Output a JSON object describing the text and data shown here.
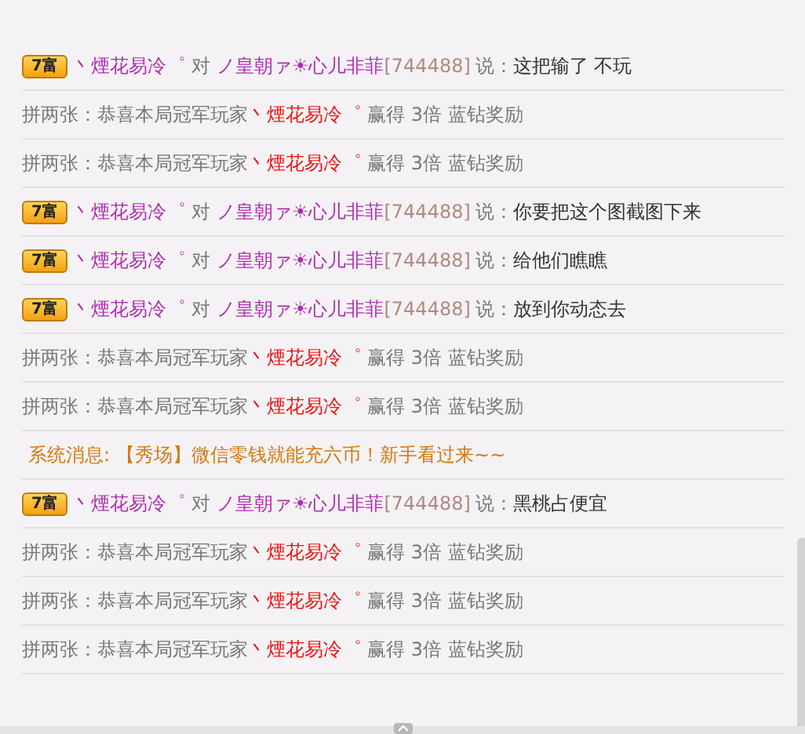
{
  "messages": [
    {
      "kind": "chat",
      "badge": "7富",
      "sender": "丶煙花易冷゜",
      "to": "对",
      "target": "ノ皇朝ァ☀心儿非菲",
      "id": "[744488]",
      "says": "说：",
      "text": "这把输了 不玩"
    },
    {
      "kind": "game",
      "prefix": "拼两张：恭喜本局冠军玩家",
      "winner": "丶煙花易冷゜",
      "reward": "赢得 3倍 蓝钻奖励"
    },
    {
      "kind": "game",
      "prefix": "拼两张：恭喜本局冠军玩家",
      "winner": "丶煙花易冷゜",
      "reward": "赢得 3倍 蓝钻奖励"
    },
    {
      "kind": "chat",
      "badge": "7富",
      "sender": "丶煙花易冷゜",
      "to": "对",
      "target": "ノ皇朝ァ☀心儿非菲",
      "id": "[744488]",
      "says": "说：",
      "text": "你要把这个图截图下来"
    },
    {
      "kind": "chat",
      "badge": "7富",
      "sender": "丶煙花易冷゜",
      "to": "对",
      "target": "ノ皇朝ァ☀心儿非菲",
      "id": "[744488]",
      "says": "说：",
      "text": "给他们瞧瞧"
    },
    {
      "kind": "chat",
      "badge": "7富",
      "sender": "丶煙花易冷゜",
      "to": "对",
      "target": "ノ皇朝ァ☀心儿非菲",
      "id": "[744488]",
      "says": "说：",
      "text": "放到你动态去"
    },
    {
      "kind": "game",
      "prefix": "拼两张：恭喜本局冠军玩家",
      "winner": "丶煙花易冷゜",
      "reward": "赢得 3倍 蓝钻奖励"
    },
    {
      "kind": "game",
      "prefix": "拼两张：恭喜本局冠军玩家",
      "winner": "丶煙花易冷゜",
      "reward": "赢得 3倍 蓝钻奖励"
    },
    {
      "kind": "system",
      "prefix": "系统消息:",
      "text": "【秀场】微信零钱就能充六币！新手看过来~~"
    },
    {
      "kind": "chat",
      "badge": "7富",
      "sender": "丶煙花易冷゜",
      "to": "对",
      "target": "ノ皇朝ァ☀心儿非菲",
      "id": "[744488]",
      "says": "说：",
      "text": "黑桃占便宜"
    },
    {
      "kind": "game",
      "prefix": "拼两张：恭喜本局冠军玩家",
      "winner": "丶煙花易冷゜",
      "reward": "赢得 3倍 蓝钻奖励"
    },
    {
      "kind": "game",
      "prefix": "拼两张：恭喜本局冠军玩家",
      "winner": "丶煙花易冷゜",
      "reward": "赢得 3倍 蓝钻奖励"
    },
    {
      "kind": "game",
      "prefix": "拼两张：恭喜本局冠军玩家",
      "winner": "丶煙花易冷゜",
      "reward": "赢得 3倍 蓝钻奖励"
    }
  ]
}
